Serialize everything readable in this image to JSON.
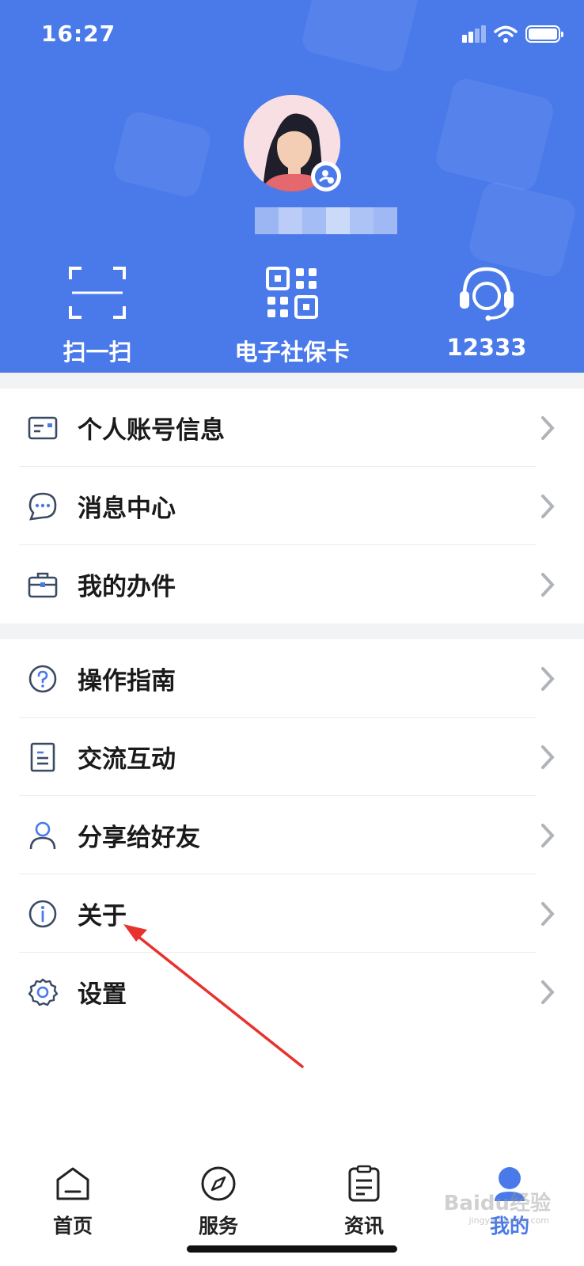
{
  "status_bar": {
    "time": "16:27"
  },
  "profile": {
    "username_blurred": true
  },
  "quick_actions": [
    {
      "label": "扫一扫",
      "icon": "scan-icon"
    },
    {
      "label": "电子社保卡",
      "icon": "qr-code-icon"
    },
    {
      "label": "12333",
      "icon": "headset-icon"
    }
  ],
  "menu_group_1": [
    {
      "label": "个人账号信息",
      "icon": "id-card-icon"
    },
    {
      "label": "消息中心",
      "icon": "message-icon"
    },
    {
      "label": "我的办件",
      "icon": "briefcase-icon"
    }
  ],
  "menu_group_2": [
    {
      "label": "操作指南",
      "icon": "question-icon"
    },
    {
      "label": "交流互动",
      "icon": "document-icon"
    },
    {
      "label": "分享给好友",
      "icon": "person-icon"
    },
    {
      "label": "关于",
      "icon": "info-icon"
    },
    {
      "label": "设置",
      "icon": "gear-icon"
    }
  ],
  "tabs": [
    {
      "label": "首页",
      "icon": "home-icon",
      "active": false
    },
    {
      "label": "服务",
      "icon": "compass-icon",
      "active": false
    },
    {
      "label": "资讯",
      "icon": "news-icon",
      "active": false
    },
    {
      "label": "我的",
      "icon": "user-icon",
      "active": true
    }
  ],
  "colors": {
    "brand": "#4a7aea",
    "arrow": "#e8322d",
    "background": "#f2f3f5"
  },
  "watermark": {
    "text": "Baidu经验",
    "sub": "jingyan.baidu.com"
  }
}
